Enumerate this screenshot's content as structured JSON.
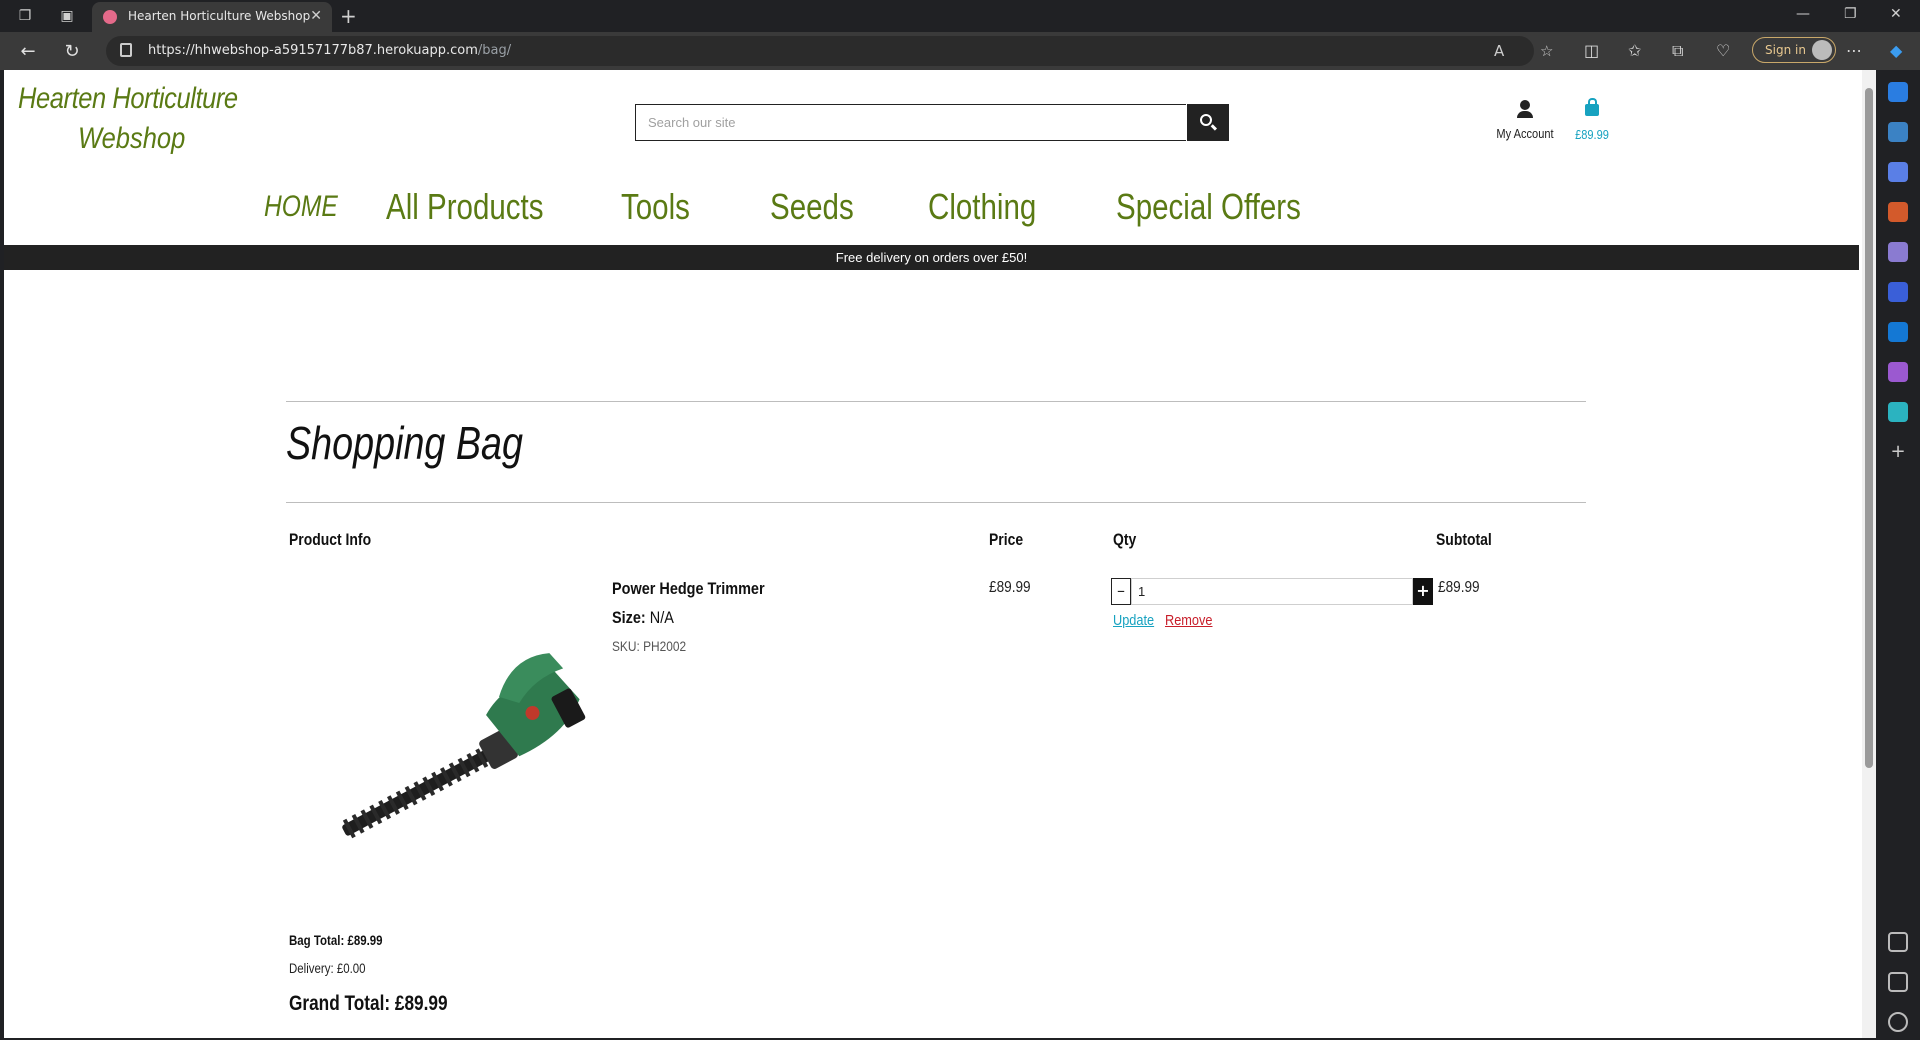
{
  "browser": {
    "tab_title": "Hearten Horticulture Webshop",
    "url_host": "https://hhwebshop-a59157177b87.herokuapp.com",
    "url_path": "/bag/",
    "signin_label": "Sign in"
  },
  "site": {
    "logo_line1": "Hearten Horticulture",
    "logo_line2": "Webshop",
    "search_placeholder": "Search our site",
    "account_label": "My Account",
    "bag_total_header": "£89.99",
    "nav": [
      "HOME",
      "All Products",
      "Tools",
      "Seeds",
      "Clothing",
      "Special Offers"
    ],
    "banner": "Free delivery on orders over £50!"
  },
  "bag": {
    "title": "Shopping Bag",
    "headers": {
      "product": "Product Info",
      "price": "Price",
      "qty": "Qty",
      "subtotal": "Subtotal"
    },
    "item": {
      "name": "Power Hedge Trimmer",
      "size_label": "Size:",
      "size_value": "N/A",
      "sku": "SKU: PH2002",
      "price": "£89.99",
      "qty": "1",
      "subtotal": "£89.99",
      "qty_minus": "–",
      "qty_plus": "+",
      "update_label": "Update",
      "remove_label": "Remove"
    },
    "bag_total": "Bag Total: £89.99",
    "delivery": "Delivery: £0.00",
    "grand_total": "Grand Total: £89.99"
  },
  "colors": {
    "brand_green": "#5a7a14",
    "accent_cyan": "#17a2c0",
    "remove_red": "#c81e2a"
  }
}
